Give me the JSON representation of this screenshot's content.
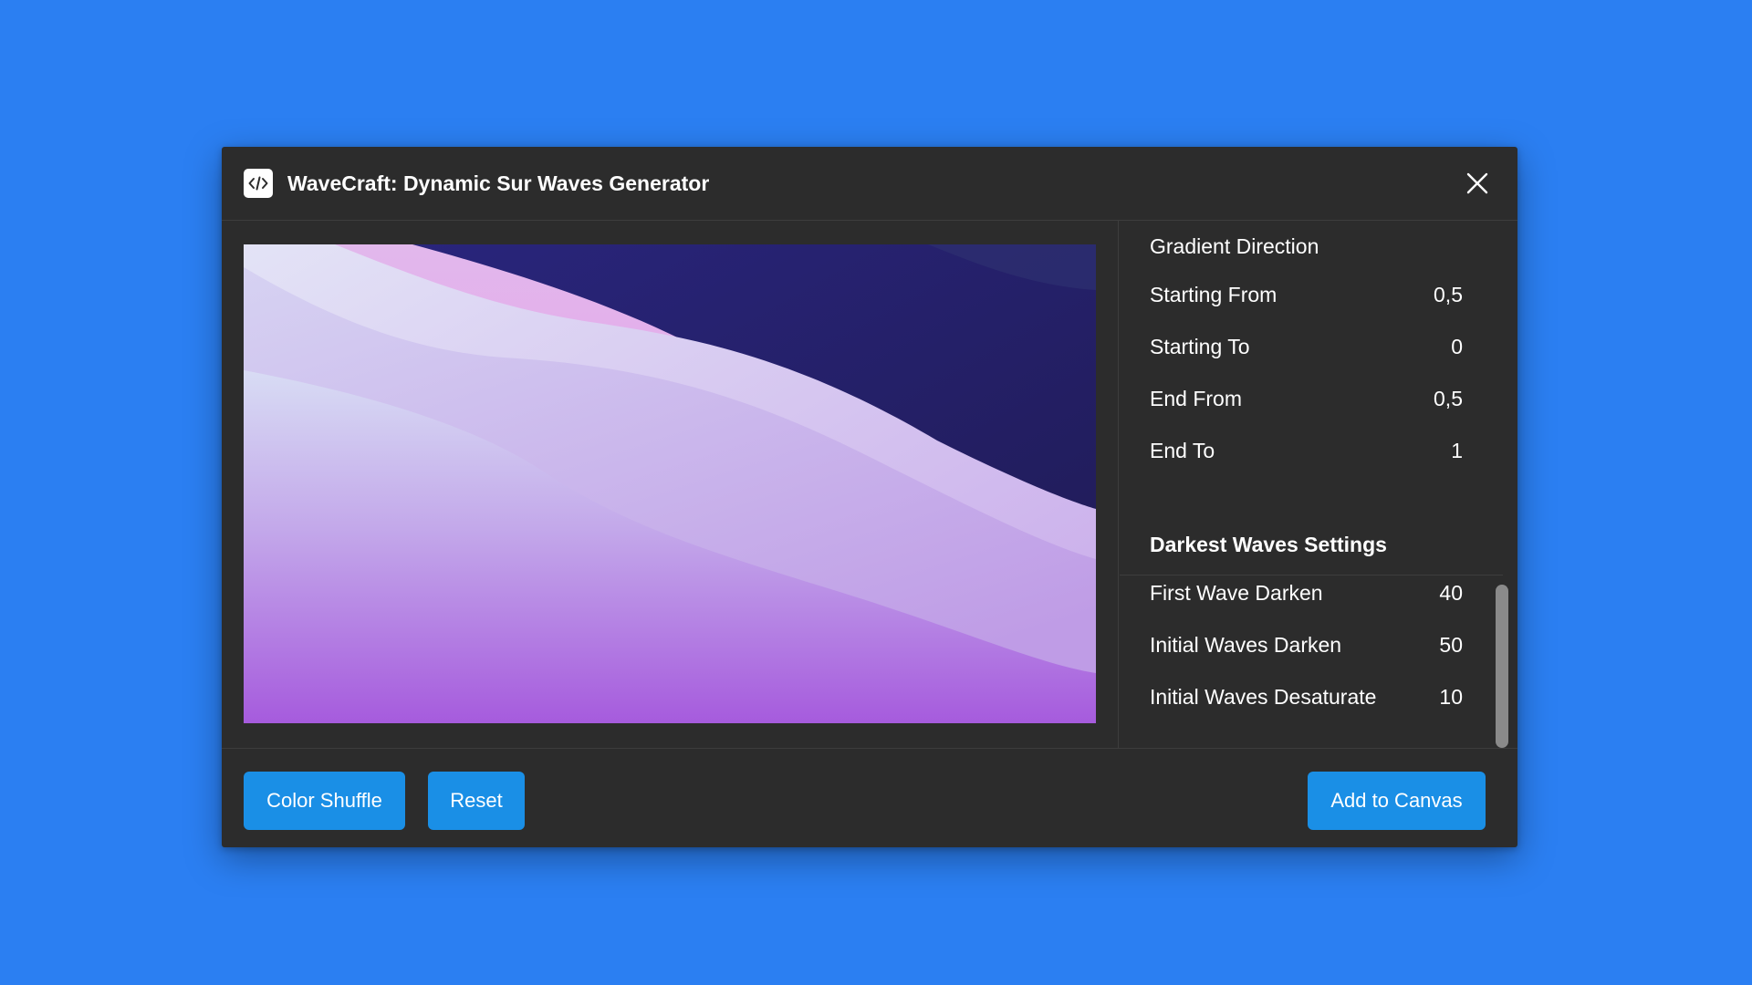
{
  "window": {
    "title": "WaveCraft: Dynamic Sur Waves Generator",
    "icon": "code-icon",
    "close_icon": "close-icon"
  },
  "settings": {
    "gradient_heading": "Gradient Direction",
    "gradient_rows": [
      {
        "label": "Starting From",
        "value": "0,5"
      },
      {
        "label": "Starting To",
        "value": "0"
      },
      {
        "label": "End From",
        "value": "0,5"
      },
      {
        "label": "End To",
        "value": "1"
      }
    ],
    "darkest_heading": "Darkest Waves Settings",
    "darkest_rows": [
      {
        "label": "First Wave Darken",
        "value": "40"
      },
      {
        "label": "Initial Waves Darken",
        "value": "50"
      },
      {
        "label": "Initial Waves Desaturate",
        "value": "10"
      }
    ]
  },
  "footer": {
    "color_shuffle_label": "Color Shuffle",
    "reset_label": "Reset",
    "add_to_canvas_label": "Add to Canvas"
  },
  "colors": {
    "background": "#2b7ff2",
    "panel": "#2c2c2c",
    "button": "#1a8fe6",
    "wave_dark": "#241d5e",
    "wave_pink": "#e9a3ea",
    "wave_light": "#dcdcf4",
    "wave_bottom": "#a658dc"
  }
}
